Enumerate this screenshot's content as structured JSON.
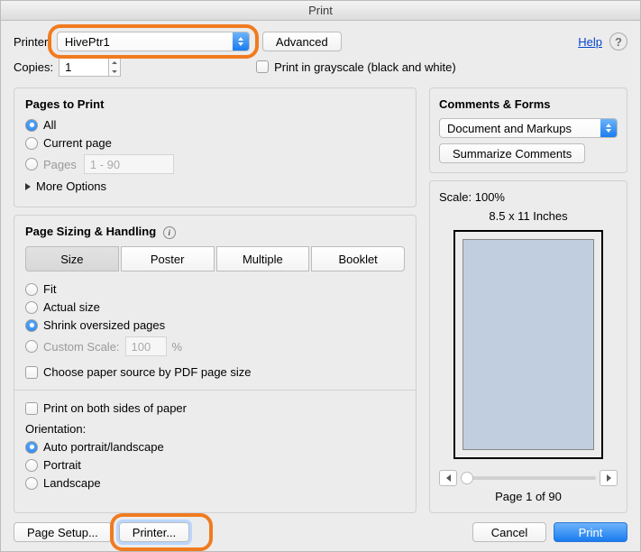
{
  "window": {
    "title": "Print"
  },
  "top": {
    "printer_label": "Printer:",
    "printer_value": "HivePtr1",
    "advanced": "Advanced",
    "help": "Help",
    "copies_label": "Copies:",
    "copies_value": "1",
    "grayscale": "Print in grayscale (black and white)"
  },
  "pages": {
    "title": "Pages to Print",
    "all": "All",
    "current": "Current page",
    "pages": "Pages",
    "pages_placeholder": "1 - 90",
    "more_options": "More Options"
  },
  "sizing": {
    "title": "Page Sizing & Handling",
    "size": "Size",
    "poster": "Poster",
    "multiple": "Multiple",
    "booklet": "Booklet",
    "fit": "Fit",
    "actual_size": "Actual size",
    "shrink": "Shrink oversized pages",
    "custom_scale": "Custom Scale:",
    "custom_value": "100",
    "custom_pct": "%",
    "choose_paper": "Choose paper source by PDF page size"
  },
  "duplex": {
    "both_sides": "Print on both sides of paper",
    "orientation_label": "Orientation:",
    "auto": "Auto portrait/landscape",
    "portrait": "Portrait",
    "landscape": "Landscape"
  },
  "comments": {
    "title": "Comments & Forms",
    "mode": "Document and Markups",
    "summarize": "Summarize Comments"
  },
  "preview": {
    "scale": "Scale: 100%",
    "paper_size": "8.5 x 11 Inches",
    "page_status": "Page 1 of 90"
  },
  "footer": {
    "page_setup": "Page Setup...",
    "printer_btn": "Printer...",
    "cancel": "Cancel",
    "print": "Print"
  }
}
